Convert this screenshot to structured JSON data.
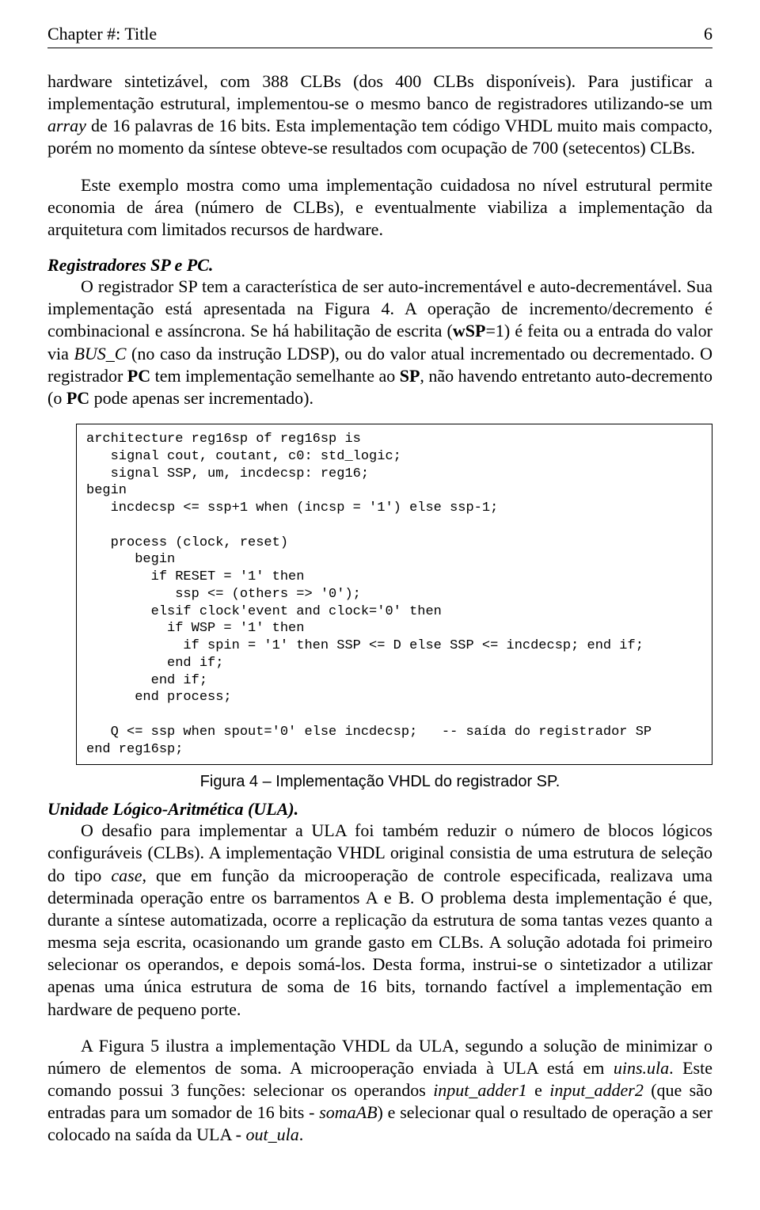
{
  "header": {
    "left": "Chapter #:  Title",
    "right": "6"
  },
  "p1": {
    "t1": "hardware sintetizável, com 388 CLBs (dos 400 CLBs disponíveis). Para justificar a implementação estrutural, implementou-se o mesmo banco de registradores utilizando-se um ",
    "t2": "array",
    "t3": " de 16 palavras de 16 bits. Esta implementação tem código VHDL muito mais compacto, porém no momento da síntese obteve-se resultados com ocupação de 700 (setecentos) CLBs."
  },
  "p2": "Este exemplo mostra como uma implementação cuidadosa no nível estrutural permite economia de área (número de CLBs), e eventualmente viabiliza a implementação da arquitetura com limitados recursos de hardware.",
  "s1_title": "Registradores SP e PC.",
  "p3": {
    "t1": "O registrador SP tem a característica de ser auto-incrementável e auto-decrementável. Sua implementação está apresentada na Figura 4. A operação de incremento/decremento é combinacional e assíncrona. Se há habilitação de escrita (",
    "t2": "wSP",
    "t3": "=1) é feita ou a entrada do valor via ",
    "t4": "BUS_C",
    "t5": " (no caso da instrução LDSP), ou do valor atual incrementado ou decrementado. O registrador ",
    "t6": "PC",
    "t7": " tem implementação semelhante ao ",
    "t8": "SP",
    "t9": ", não havendo entretanto auto-decremento (o ",
    "t10": "PC",
    "t11": " pode apenas ser incrementado)."
  },
  "code": "architecture reg16sp of reg16sp is\n   signal cout, coutant, c0: std_logic;\n   signal SSP, um, incdecsp: reg16;\nbegin\n   incdecsp <= ssp+1 when (incsp = '1') else ssp-1;\n\n   process (clock, reset)\n      begin\n        if RESET = '1' then\n           ssp <= (others => '0');\n        elsif clock'event and clock='0' then\n          if WSP = '1' then\n            if spin = '1' then SSP <= D else SSP <= incdecsp; end if;\n          end if;\n        end if;\n      end process;\n\n   Q <= ssp when spout='0' else incdecsp;   -- saída do registrador SP\nend reg16sp;",
  "figcap": "Figura 4 – Implementação VHDL do registrador SP.",
  "s2_title": "Unidade Lógico-Aritmética (ULA).",
  "p4": {
    "t1": "O desafio para implementar a ULA foi também reduzir o número de blocos lógicos configuráveis (CLBs). A implementação VHDL original consistia de uma estrutura de seleção do tipo ",
    "t2": "case",
    "t3": ", que em função da microoperação de controle especificada, realizava uma determinada operação entre os barramentos A e B. O problema desta implementação é que, durante a síntese automatizada, ocorre a replicação da estrutura de soma tantas vezes quanto a mesma seja escrita, ocasionando um grande gasto em CLBs. A solução adotada foi primeiro selecionar os operandos, e depois somá-los. Desta forma, instrui-se o sintetizador a utilizar apenas uma única estrutura de soma de 16 bits, tornando factível a implementação em hardware de pequeno porte."
  },
  "p5": {
    "t1": "A Figura 5 ilustra a implementação VHDL da ULA, segundo a solução de minimizar o número de elementos de soma. A microoperação enviada à ULA está em ",
    "t2": "uins.ula",
    "t3": ". Este comando possui 3 funções: selecionar os operandos ",
    "t4": "input_adder1",
    "t5": " e ",
    "t6": "input_adder2",
    "t7": " (que são entradas para um somador de 16 bits - ",
    "t8": "somaAB",
    "t9": ") e selecionar qual o resultado de operação a ser colocado na saída da ULA - ",
    "t10": "out_ula",
    "t11": "."
  }
}
